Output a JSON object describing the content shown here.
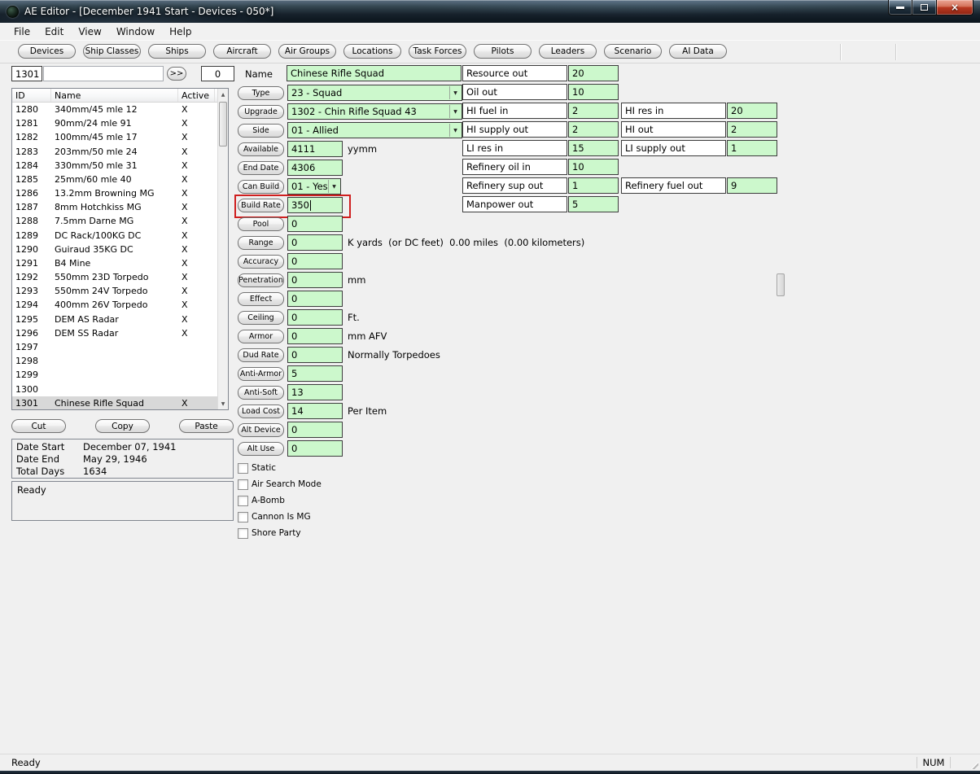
{
  "icons": {
    "close": "×",
    "dropdown_arrow": "▼",
    "scroll_up": "▲",
    "scroll_down": "▼"
  },
  "window": {
    "title": "AE Editor - [December 1941 Start - Devices - 050*]"
  },
  "menu": {
    "items": [
      {
        "label": "File"
      },
      {
        "label": "Edit"
      },
      {
        "label": "View"
      },
      {
        "label": "Window"
      },
      {
        "label": "Help"
      }
    ]
  },
  "toolbar": {
    "tabs": [
      {
        "label": "Devices"
      },
      {
        "label": "Ship Classes"
      },
      {
        "label": "Ships"
      },
      {
        "label": "Aircraft"
      },
      {
        "label": "Air Groups"
      },
      {
        "label": "Locations"
      },
      {
        "label": "Task Forces"
      },
      {
        "label": "Pilots"
      },
      {
        "label": "Leaders"
      },
      {
        "label": "Scenario"
      },
      {
        "label": "AI Data"
      }
    ]
  },
  "left_panel": {
    "record_id": "1301",
    "search_value": "",
    "go_button": ">>",
    "counter": "0",
    "table": {
      "headers": [
        "ID",
        "Name",
        "Active"
      ],
      "rows": [
        {
          "id": "1280",
          "name": "340mm/45 mle 12",
          "active": "X"
        },
        {
          "id": "1281",
          "name": "90mm/24 mle 91",
          "active": "X"
        },
        {
          "id": "1282",
          "name": "100mm/45 mle 17",
          "active": "X"
        },
        {
          "id": "1283",
          "name": "203mm/50 mle 24",
          "active": "X"
        },
        {
          "id": "1284",
          "name": "330mm/50 mle 31",
          "active": "X"
        },
        {
          "id": "1285",
          "name": "25mm/60 mle 40",
          "active": "X"
        },
        {
          "id": "1286",
          "name": "13.2mm Browning MG",
          "active": "X"
        },
        {
          "id": "1287",
          "name": "8mm Hotchkiss MG",
          "active": "X"
        },
        {
          "id": "1288",
          "name": "7.5mm Darne MG",
          "active": "X"
        },
        {
          "id": "1289",
          "name": "DC Rack/100KG DC",
          "active": "X"
        },
        {
          "id": "1290",
          "name": "Guiraud 35KG DC",
          "active": "X"
        },
        {
          "id": "1291",
          "name": "B4 Mine",
          "active": "X"
        },
        {
          "id": "1292",
          "name": "550mm 23D Torpedo",
          "active": "X"
        },
        {
          "id": "1293",
          "name": "550mm 24V Torpedo",
          "active": "X"
        },
        {
          "id": "1294",
          "name": "400mm 26V Torpedo",
          "active": "X"
        },
        {
          "id": "1295",
          "name": "DEM AS Radar",
          "active": "X"
        },
        {
          "id": "1296",
          "name": "DEM SS Radar",
          "active": "X"
        },
        {
          "id": "1297",
          "name": "",
          "active": ""
        },
        {
          "id": "1298",
          "name": "",
          "active": ""
        },
        {
          "id": "1299",
          "name": "",
          "active": ""
        },
        {
          "id": "1300",
          "name": "",
          "active": ""
        },
        {
          "id": "1301",
          "name": "Chinese Rifle Squad",
          "active": "X",
          "selected": true
        }
      ]
    },
    "cut_button": "Cut",
    "copy_button": "Copy",
    "paste_button": "Paste",
    "scenario_info": [
      {
        "label": "Date Start",
        "value": "December 07, 1941"
      },
      {
        "label": "Date End",
        "value": "May 29, 1946"
      },
      {
        "label": "Total Days",
        "value": "1634"
      }
    ],
    "status_box": "Ready"
  },
  "device_form": {
    "name_label": "Name",
    "name_value": "Chinese Rifle Squad",
    "rows": [
      {
        "label": "Type",
        "value": "23 - Squad",
        "kind": "select wide"
      },
      {
        "label": "Upgrade",
        "value": "1302 - Chin Rifle Squad 43",
        "kind": "select wide"
      },
      {
        "label": "Side",
        "value": "01 - Allied",
        "kind": "select wide"
      },
      {
        "label": "Available",
        "value": "4111",
        "kind": "input",
        "suffix": "yymm"
      },
      {
        "label": "End Date",
        "value": "4306",
        "kind": "input"
      },
      {
        "label": "Can Build",
        "value": "01 - Yes",
        "kind": "select small"
      },
      {
        "label": "Build Rate",
        "value": "350",
        "kind": "input",
        "highlight": true,
        "caret": true
      },
      {
        "label": "Pool",
        "value": "0",
        "kind": "input"
      },
      {
        "label": "Range",
        "value": "0",
        "kind": "input",
        "suffix": "K yards  (or DC feet)  0.00 miles  (0.00 kilometers)"
      },
      {
        "label": "Accuracy",
        "value": "0",
        "kind": "input"
      },
      {
        "label": "Penetration",
        "value": "0",
        "kind": "input",
        "suffix": "mm"
      },
      {
        "label": "Effect",
        "value": "0",
        "kind": "input"
      },
      {
        "label": "Ceiling",
        "value": "0",
        "kind": "input",
        "suffix": "Ft."
      },
      {
        "label": "Armor",
        "value": "0",
        "kind": "input",
        "suffix": "mm AFV"
      },
      {
        "label": "Dud Rate",
        "value": "0",
        "kind": "input",
        "suffix": "Normally Torpedoes"
      },
      {
        "label": "Anti-Armor",
        "value": "5",
        "kind": "input"
      },
      {
        "label": "Anti-Soft",
        "value": "13",
        "kind": "input"
      },
      {
        "label": "Load Cost",
        "value": "14",
        "kind": "input",
        "suffix": "Per Item"
      },
      {
        "label": "Alt Device",
        "value": "0",
        "kind": "input"
      },
      {
        "label": "Alt Use",
        "value": "0",
        "kind": "input"
      }
    ],
    "checkboxes": [
      {
        "label": "Static",
        "checked": false
      },
      {
        "label": "Air Search Mode",
        "checked": false
      },
      {
        "label": "A-Bomb",
        "checked": false
      },
      {
        "label": "Cannon Is MG",
        "checked": false
      },
      {
        "label": "Shore Party",
        "checked": false
      }
    ]
  },
  "economy_panel": {
    "rows": [
      {
        "label": "Resource out",
        "value": "20"
      },
      {
        "label": "Oil out",
        "value": "10"
      },
      {
        "label": "HI fuel in",
        "value": "2",
        "label2": "HI res in",
        "value2": "20"
      },
      {
        "label": "HI supply out",
        "value": "2",
        "label2": "HI out",
        "value2": "2"
      },
      {
        "label": "LI res in",
        "value": "15",
        "label2": "LI supply out",
        "value2": "1"
      },
      {
        "label": "Refinery oil in",
        "value": "10"
      },
      {
        "label": "Refinery sup out",
        "value": "1",
        "label2": "Refinery fuel out",
        "value2": "9"
      },
      {
        "label": "Manpower out",
        "value": "5"
      }
    ]
  },
  "status_bar": {
    "left": "Ready",
    "right": "NUM"
  }
}
